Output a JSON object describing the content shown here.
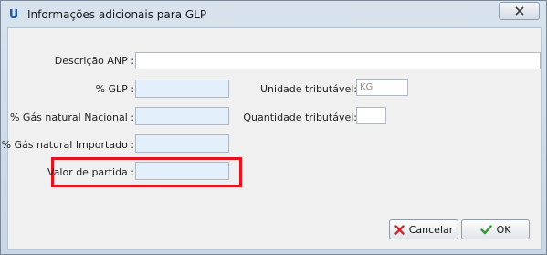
{
  "window": {
    "title": "Informações adicionais para GLP",
    "close_icon": "close-icon"
  },
  "form": {
    "descricao_anp": {
      "label": "Descrição ANP :",
      "value": ""
    },
    "glp": {
      "label": "% GLP :",
      "value": ""
    },
    "gas_nacional": {
      "label": "% Gás natural Nacional :",
      "value": ""
    },
    "gas_importado": {
      "label": "% Gás natural Importado :",
      "value": ""
    },
    "valor_partida": {
      "label": "Valor de partida :",
      "value": ""
    },
    "unidade_tributavel": {
      "label": "Unidade tributável:",
      "value": "KG"
    },
    "quantidade_tributavel": {
      "label": "Quantidade tributável:",
      "value": ""
    }
  },
  "buttons": {
    "cancel": {
      "label": "Cancelar",
      "icon": "x-icon"
    },
    "ok": {
      "label": "OK",
      "icon": "checkmark-icon"
    }
  },
  "colors": {
    "highlight": "#e3141e",
    "blue_field": "#e3effb",
    "cancel_icon": "#d6262b",
    "ok_icon": "#2e9b2e"
  }
}
